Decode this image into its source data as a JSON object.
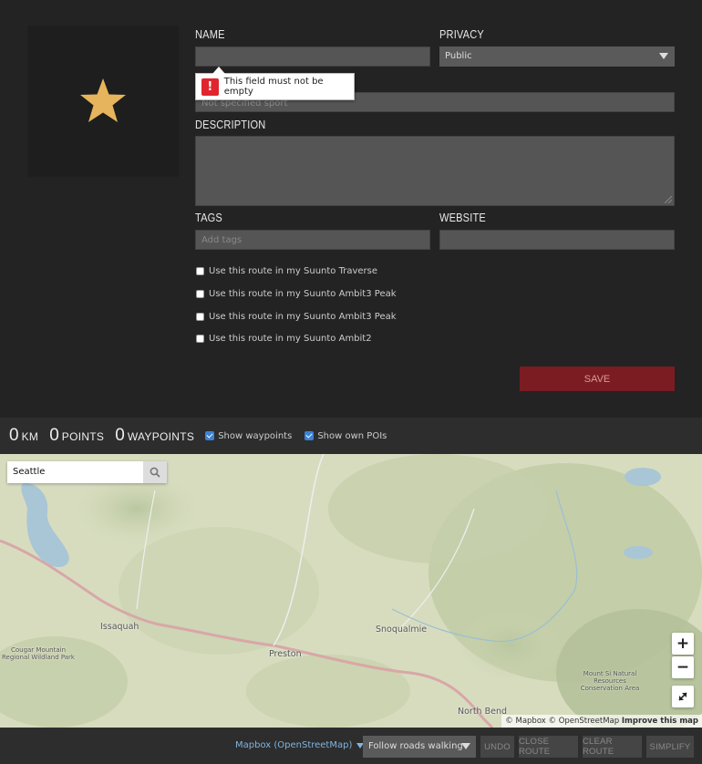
{
  "form": {
    "name_label": "NAME",
    "name_value": "",
    "privacy_label": "PRIVACY",
    "privacy_value": "Public",
    "sport_placeholder": "Not specified sport",
    "validation_message": "This field must not be empty",
    "description_label": "DESCRIPTION",
    "tags_label": "TAGS",
    "tags_placeholder": "Add tags",
    "website_label": "WEBSITE",
    "checkboxes": [
      {
        "label": "Use this route in my Suunto Traverse",
        "checked": false
      },
      {
        "label": "Use this route in my Suunto Ambit3 Peak",
        "checked": false
      },
      {
        "label": "Use this route in my Suunto Ambit3 Peak",
        "checked": false
      },
      {
        "label": "Use this route in my Suunto Ambit2",
        "checked": false
      }
    ],
    "save_label": "SAVE",
    "thumbnail_icon": "star-icon"
  },
  "stats": {
    "distance_value": "0",
    "distance_unit": "KM",
    "points_value": "0",
    "points_unit": "POINTS",
    "waypoints_value": "0",
    "waypoints_unit": "WAYPOINTS",
    "show_waypoints_label": "Show waypoints",
    "show_waypoints_checked": true,
    "show_pois_label": "Show own POIs",
    "show_pois_checked": true
  },
  "map": {
    "search_value": "Seattle",
    "places": [
      "Issaquah",
      "Preston",
      "Snoqualmie",
      "North Bend",
      "Cougar Mountain Regional Wildland Park",
      "Mount Si Natural Resources Conservation Area"
    ],
    "attribution": "© Mapbox © OpenStreetMap",
    "improve_link": "Improve this map",
    "zoom_in": "+",
    "zoom_out": "−"
  },
  "toolbar": {
    "map_source": "Mapbox (OpenStreetMap)",
    "routing_mode": "Follow roads walking",
    "undo": "UNDO",
    "close_route": "CLOSE ROUTE",
    "clear_route": "CLEAR ROUTE",
    "simplify": "SIMPLIFY"
  },
  "colors": {
    "accent_save": "#7a1c22",
    "star": "#e6b45c",
    "error": "#e0262c",
    "checkbox": "#3b82d6"
  }
}
